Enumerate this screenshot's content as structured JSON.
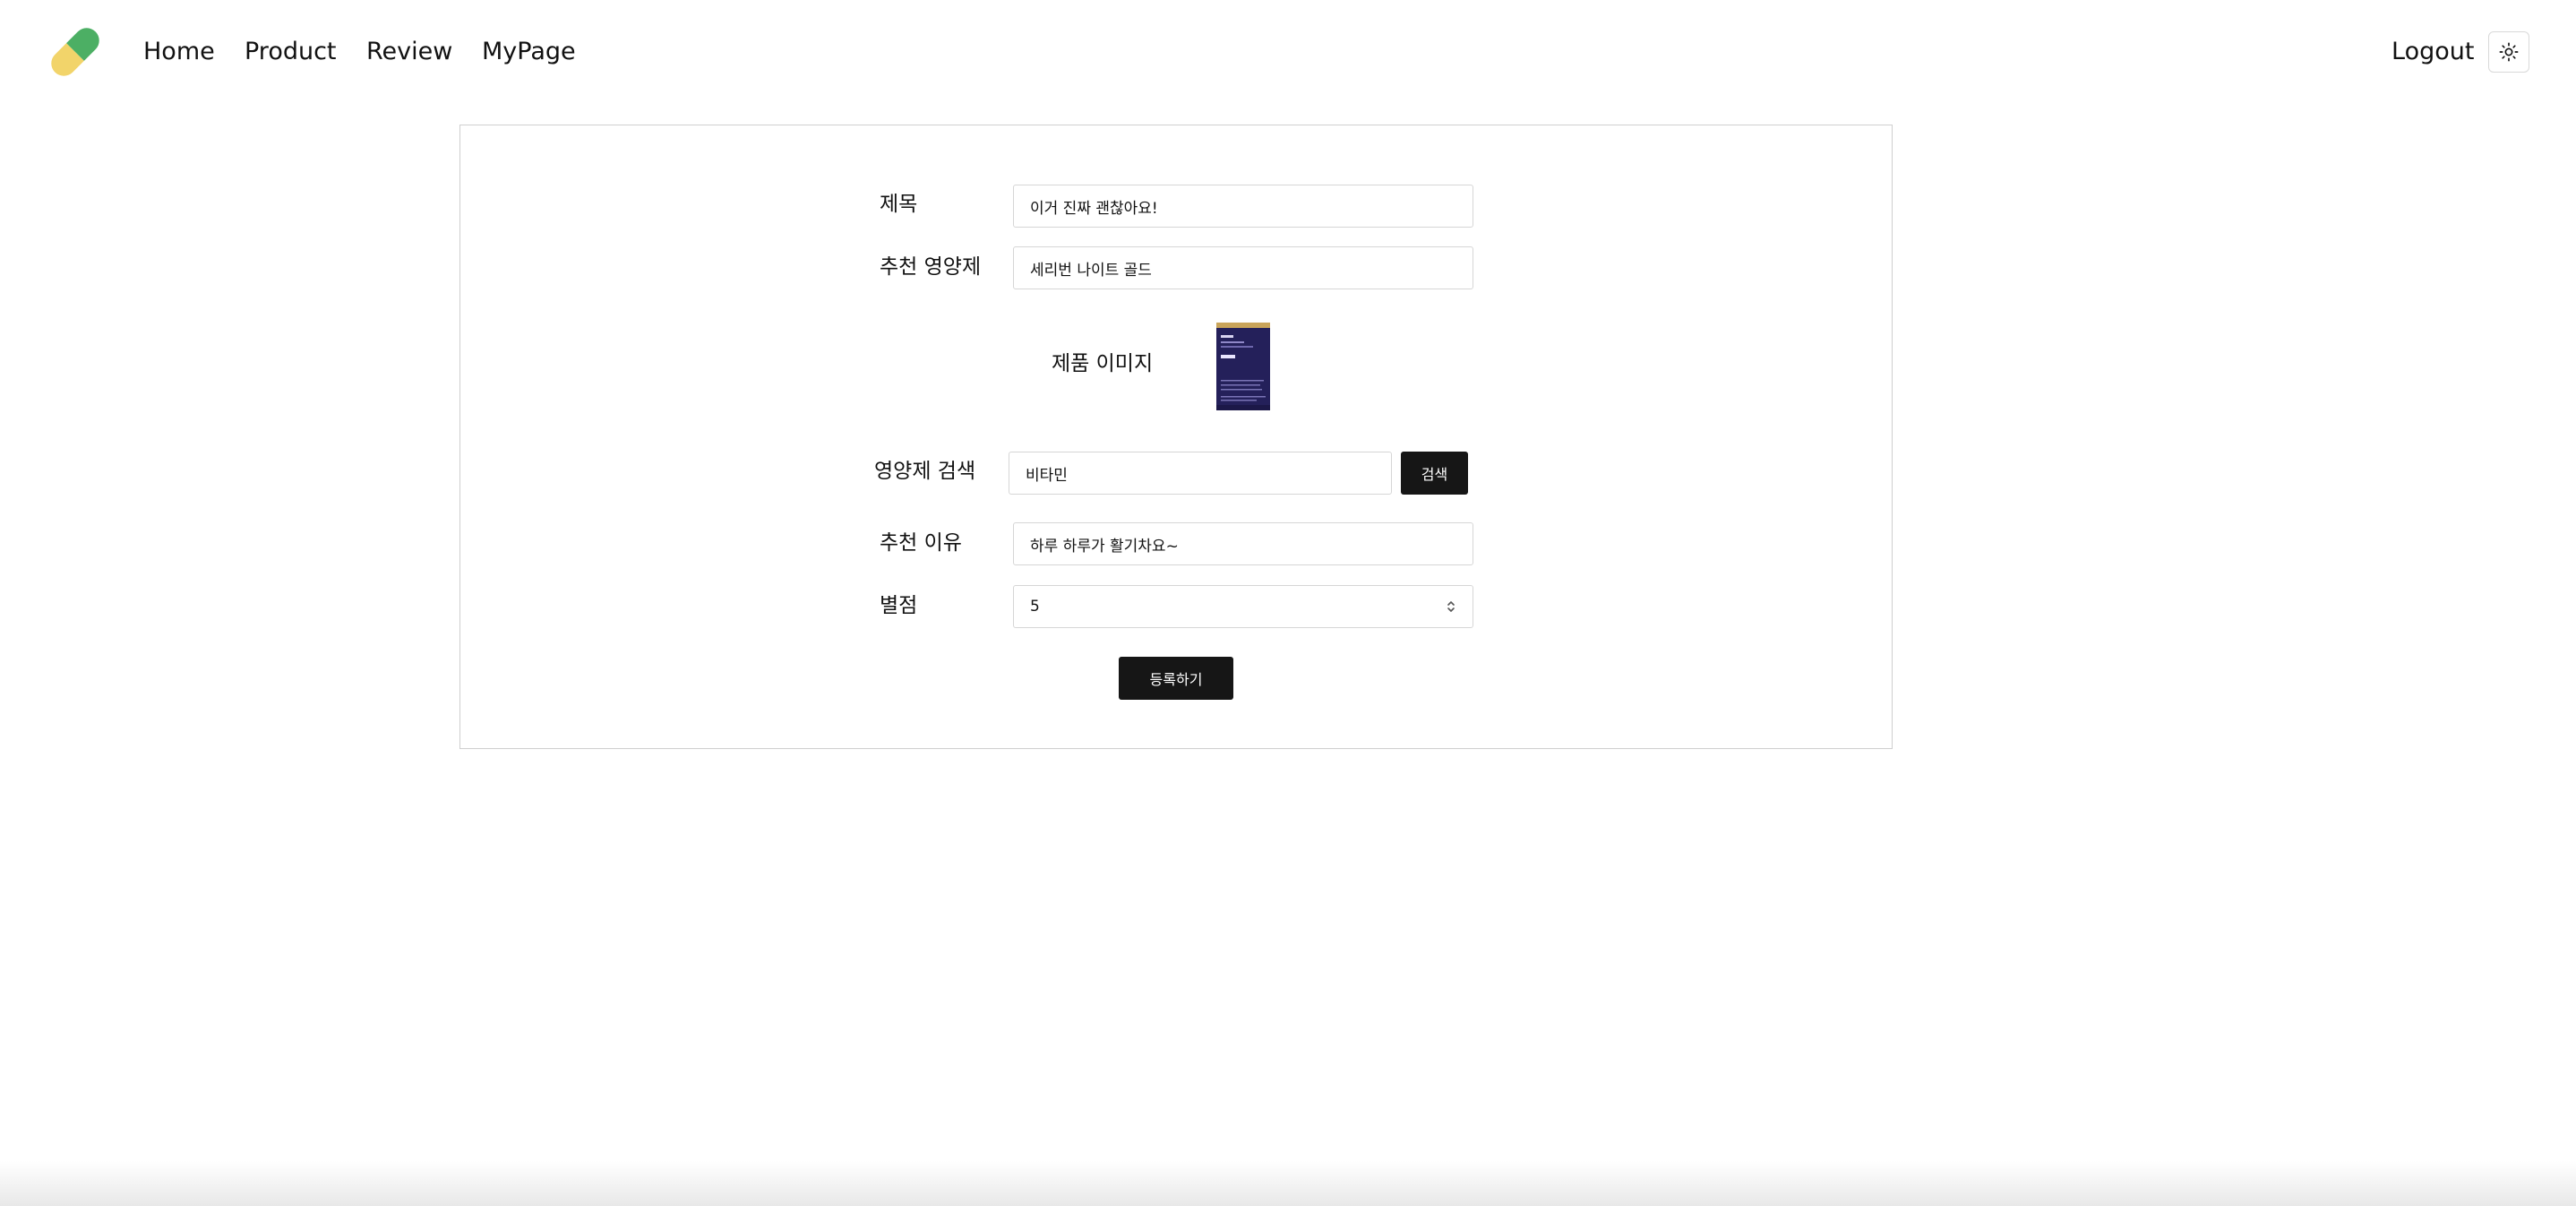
{
  "header": {
    "nav": {
      "home": "Home",
      "product": "Product",
      "review": "Review",
      "mypage": "MyPage"
    },
    "logout": "Logout",
    "theme_icon": "sun-icon",
    "logo_icon": "pill-capsule-icon",
    "logo_colors": {
      "green": "#4CAF64",
      "yellow": "#F2D46A"
    }
  },
  "form": {
    "title_label": "제목",
    "title_value": "이거 진짜 괜찮아요!",
    "supplement_label": "추천 영양제",
    "supplement_value": "세리번 나이트 골드",
    "image_label": "제품 이미지",
    "search_label": "영양제 검색",
    "search_value": "비타민",
    "search_button": "검색",
    "reason_label": "추천 이유",
    "reason_value": "하루 하루가 활기차요~",
    "rating_label": "별점",
    "rating_value": "5",
    "submit_button": "등록하기"
  },
  "colors": {
    "button_bg": "#161616",
    "border": "#d6d6d6",
    "card_border": "#cfcfcf"
  }
}
